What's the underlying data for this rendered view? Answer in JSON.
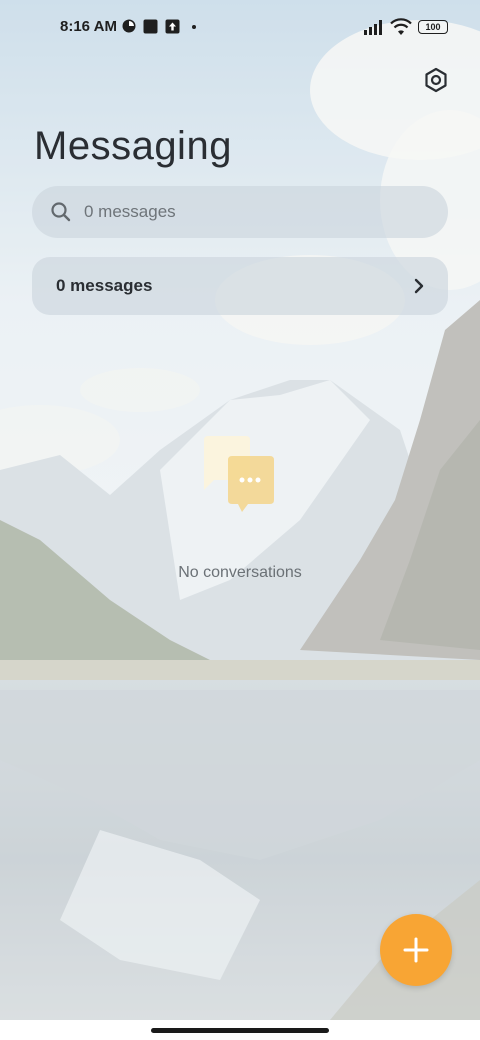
{
  "status_bar": {
    "time": "8:16 AM",
    "battery": "100",
    "icons": [
      "app-notification-icon",
      "square-notification-icon",
      "upload-notification-icon",
      "dot-icon",
      "signal-icon",
      "wifi-icon",
      "battery-icon"
    ]
  },
  "header": {
    "title": "Messaging",
    "settings_icon": "settings-hexagon-icon"
  },
  "search": {
    "placeholder": "0 messages"
  },
  "messages_row": {
    "label": "0 messages"
  },
  "empty_state": {
    "text": "No conversations"
  },
  "fab": {
    "icon": "plus-icon",
    "color": "#f8a534"
  },
  "colors": {
    "accent": "#f8a534",
    "text_primary": "#2a2e33",
    "text_secondary": "#6b7176"
  }
}
